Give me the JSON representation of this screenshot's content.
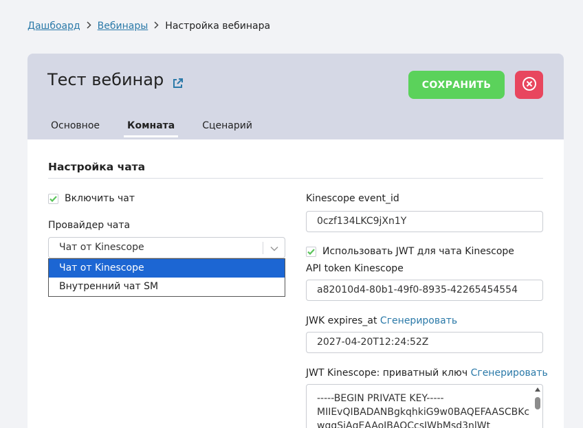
{
  "breadcrumb": {
    "dashboard": "Дашбоард",
    "webinars": "Вебинары",
    "current": "Настройка вебинара"
  },
  "header": {
    "title": "Тест вебинар",
    "save_label": "СОХРАНИТЬ"
  },
  "tabs": [
    {
      "label": "Основное"
    },
    {
      "label": "Комната"
    },
    {
      "label": "Сценарий"
    }
  ],
  "section": {
    "title": "Настройка чата"
  },
  "left": {
    "enable_chat_label": "Включить чат",
    "provider_label": "Провайдер чата",
    "provider_value": "Чат от Kinescope",
    "options": [
      {
        "label": "Чат от Kinescope"
      },
      {
        "label": "Внутренний чат SM"
      }
    ]
  },
  "right": {
    "event_id_label": "Kinescope event_id",
    "event_id_value": "0czf134LKC9jXn1Y",
    "use_jwt_label": "Использовать JWT для чата Kinescope",
    "api_token_label": "API token Kinescope",
    "api_token_value": "a82010d4-80b1-49f0-8935-42265454554",
    "jwk_label": "JWK expires_at",
    "generate_link": "Сгенерировать",
    "jwk_value": "2027-04-20T12:24:52Z",
    "private_key_label": "JWT Kinescope: приватный ключ",
    "private_key_lines": [
      "-----BEGIN PRIVATE KEY-----",
      "MIIEvQIBADANBgkqhkiG9w0BAQEFAASCBKc",
      "wggSjAgEAAoIBAQCcsIWbMsd3nlWt"
    ]
  },
  "colors": {
    "accent": "#2a79a8",
    "save": "#5bd25b",
    "close": "#e8465e",
    "header_bg": "#d5d8e5",
    "check": "#5bc45b",
    "selected_option": "#1c66d3"
  }
}
